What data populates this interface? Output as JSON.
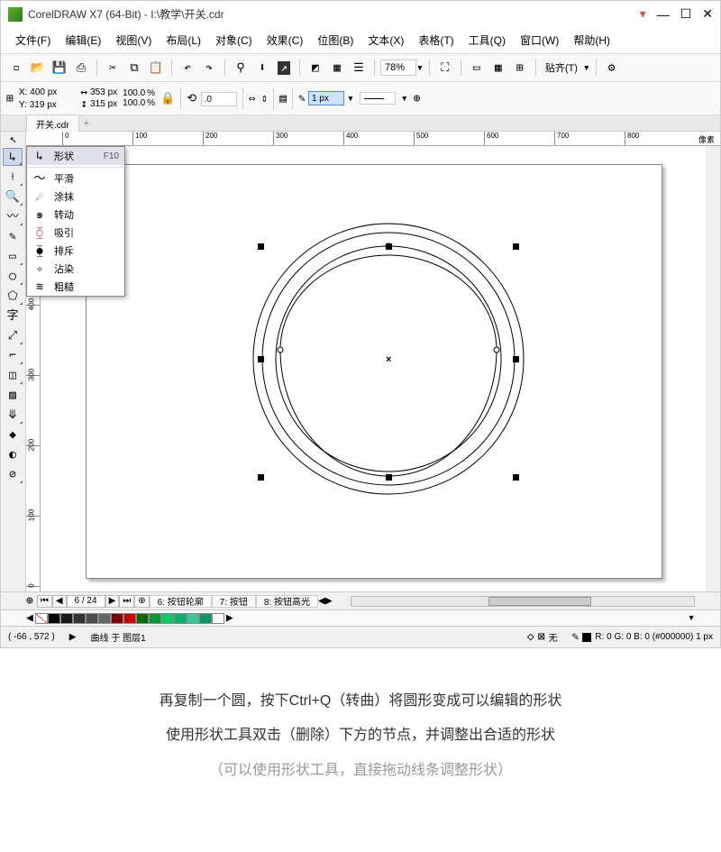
{
  "title": "CorelDRAW X7 (64-Bit) - I:\\教学\\开关.cdr",
  "menu": {
    "file": "文件(F)",
    "edit": "编辑(E)",
    "view": "视图(V)",
    "layout": "布局(L)",
    "object": "对象(C)",
    "effects": "效果(C)",
    "bitmap": "位图(B)",
    "text": "文本(X)",
    "table": "表格(T)",
    "tools": "工具(Q)",
    "window": "窗口(W)",
    "help": "帮助(H)"
  },
  "toolbar": {
    "zoom": "78%",
    "paste": "贴齐(T)"
  },
  "propbar": {
    "x_label": "X:",
    "y_label": "Y:",
    "x": "400 px",
    "y": "319 px",
    "w": "353 px",
    "h": "315 px",
    "sx": "100.0",
    "sy": "100.0",
    "pct": "%",
    "angle": ".0",
    "stroke": "1 px"
  },
  "tab_name": "开关.cdr",
  "ruler_label": "像素",
  "flyout": {
    "shape": "形状",
    "shape_key": "F10",
    "smooth": "平滑",
    "smear": "涂抹",
    "twirl": "转动",
    "attract": "吸引",
    "repel": "排斥",
    "smudge": "沾染",
    "rough": "粗糙"
  },
  "pager": {
    "count": "6 / 24",
    "t6": "6: 按钮轮廓",
    "t7": "7: 按钮",
    "t8": "8: 按钮高光"
  },
  "statusbar": {
    "coords": "( -66  ,  572 )",
    "object": "曲线 于 图层1",
    "fill_none": "无",
    "rgb": "R: 0 G: 0 B: 0 (#000000)  1 px"
  },
  "tutorial": {
    "line1": "再复制一个圆，按下Ctrl+Q（转曲）将圆形变成可以编辑的形状",
    "line2": "使用形状工具双击（删除）下方的节点，并调整出合适的形状",
    "line3": "（可以使用形状工具，直接拖动线条调整形状）"
  },
  "palette": [
    "#000000",
    "#1a1a1a",
    "#333333",
    "#4d4d4d",
    "#666666",
    "#800000",
    "#cc0000",
    "#006600",
    "#009933",
    "#00cc66",
    "#00b36b",
    "#33cc99",
    "#009966",
    "#ffffff"
  ]
}
